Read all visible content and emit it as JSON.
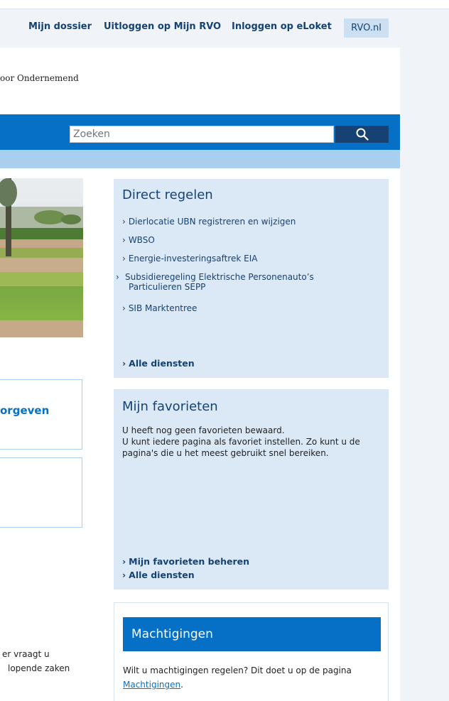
{
  "top_nav": {
    "mijn_dossier": "Mijn dossier",
    "uitloggen": "Uitloggen op Mijn RVO",
    "inloggen_eloket": "Inloggen op eLoket",
    "rvo_nl": "RVO.nl"
  },
  "header": {
    "logo_text": "oor Ondernemend"
  },
  "search": {
    "placeholder": "Zoeken"
  },
  "left": {
    "box1_label": "orgeven",
    "snippet_line1": "er vraagt u",
    "snippet_line2": "lopende zaken"
  },
  "direct_regelen": {
    "title": "Direct regelen",
    "items": [
      "Dierlocatie UBN registreren en wijzigen",
      "WBSO",
      "Energie-investeringsaftrek EIA",
      "Subsidieregeling Elektrische Personenauto’s Particulieren SEPP",
      "SIB Marktentree"
    ],
    "all_services": "Alle diensten"
  },
  "favorieten": {
    "title": "Mijn favorieten",
    "text_line1": "U heeft nog geen favorieten bewaard.",
    "text_line2": "U kunt iedere pagina als favoriet instellen. Zo kunt u de pagina's die u het meest gebruikt snel bereiken.",
    "manage": "Mijn favorieten beheren",
    "all_services": "Alle diensten"
  },
  "machtigingen": {
    "title": "Machtigingen",
    "text": "Wilt u machtigingen regelen? Dit doet u op de pagina",
    "link": "Machtigingen",
    "period": "."
  },
  "colors": {
    "dark_blue": "#154273",
    "accent_blue": "#0570c6",
    "light_blue": "#a8d0ee",
    "panel_blue": "#dbe9f6"
  }
}
